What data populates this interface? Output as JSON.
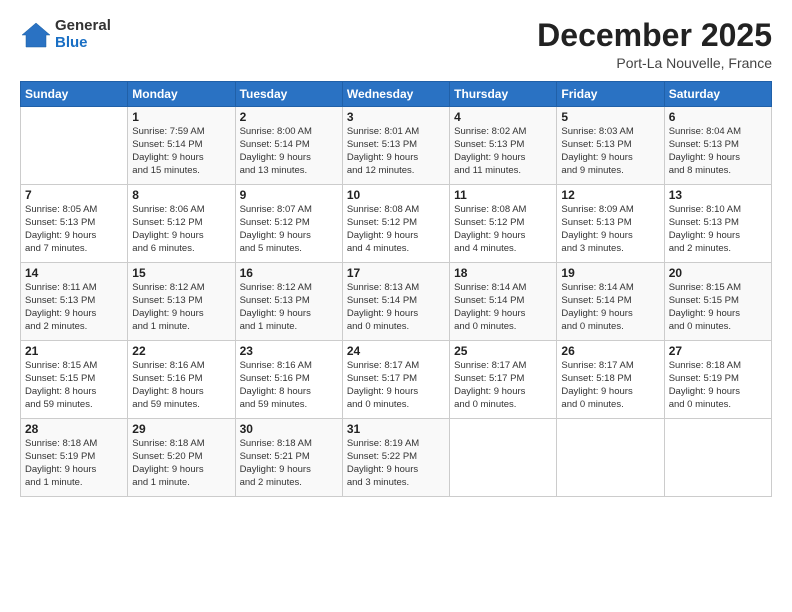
{
  "logo": {
    "general": "General",
    "blue": "Blue"
  },
  "header": {
    "month": "December 2025",
    "location": "Port-La Nouvelle, France"
  },
  "weekdays": [
    "Sunday",
    "Monday",
    "Tuesday",
    "Wednesday",
    "Thursday",
    "Friday",
    "Saturday"
  ],
  "weeks": [
    [
      {
        "day": "",
        "info": ""
      },
      {
        "day": "1",
        "info": "Sunrise: 7:59 AM\nSunset: 5:14 PM\nDaylight: 9 hours\nand 15 minutes."
      },
      {
        "day": "2",
        "info": "Sunrise: 8:00 AM\nSunset: 5:14 PM\nDaylight: 9 hours\nand 13 minutes."
      },
      {
        "day": "3",
        "info": "Sunrise: 8:01 AM\nSunset: 5:13 PM\nDaylight: 9 hours\nand 12 minutes."
      },
      {
        "day": "4",
        "info": "Sunrise: 8:02 AM\nSunset: 5:13 PM\nDaylight: 9 hours\nand 11 minutes."
      },
      {
        "day": "5",
        "info": "Sunrise: 8:03 AM\nSunset: 5:13 PM\nDaylight: 9 hours\nand 9 minutes."
      },
      {
        "day": "6",
        "info": "Sunrise: 8:04 AM\nSunset: 5:13 PM\nDaylight: 9 hours\nand 8 minutes."
      }
    ],
    [
      {
        "day": "7",
        "info": "Sunrise: 8:05 AM\nSunset: 5:13 PM\nDaylight: 9 hours\nand 7 minutes."
      },
      {
        "day": "8",
        "info": "Sunrise: 8:06 AM\nSunset: 5:12 PM\nDaylight: 9 hours\nand 6 minutes."
      },
      {
        "day": "9",
        "info": "Sunrise: 8:07 AM\nSunset: 5:12 PM\nDaylight: 9 hours\nand 5 minutes."
      },
      {
        "day": "10",
        "info": "Sunrise: 8:08 AM\nSunset: 5:12 PM\nDaylight: 9 hours\nand 4 minutes."
      },
      {
        "day": "11",
        "info": "Sunrise: 8:08 AM\nSunset: 5:12 PM\nDaylight: 9 hours\nand 4 minutes."
      },
      {
        "day": "12",
        "info": "Sunrise: 8:09 AM\nSunset: 5:13 PM\nDaylight: 9 hours\nand 3 minutes."
      },
      {
        "day": "13",
        "info": "Sunrise: 8:10 AM\nSunset: 5:13 PM\nDaylight: 9 hours\nand 2 minutes."
      }
    ],
    [
      {
        "day": "14",
        "info": "Sunrise: 8:11 AM\nSunset: 5:13 PM\nDaylight: 9 hours\nand 2 minutes."
      },
      {
        "day": "15",
        "info": "Sunrise: 8:12 AM\nSunset: 5:13 PM\nDaylight: 9 hours\nand 1 minute."
      },
      {
        "day": "16",
        "info": "Sunrise: 8:12 AM\nSunset: 5:13 PM\nDaylight: 9 hours\nand 1 minute."
      },
      {
        "day": "17",
        "info": "Sunrise: 8:13 AM\nSunset: 5:14 PM\nDaylight: 9 hours\nand 0 minutes."
      },
      {
        "day": "18",
        "info": "Sunrise: 8:14 AM\nSunset: 5:14 PM\nDaylight: 9 hours\nand 0 minutes."
      },
      {
        "day": "19",
        "info": "Sunrise: 8:14 AM\nSunset: 5:14 PM\nDaylight: 9 hours\nand 0 minutes."
      },
      {
        "day": "20",
        "info": "Sunrise: 8:15 AM\nSunset: 5:15 PM\nDaylight: 9 hours\nand 0 minutes."
      }
    ],
    [
      {
        "day": "21",
        "info": "Sunrise: 8:15 AM\nSunset: 5:15 PM\nDaylight: 8 hours\nand 59 minutes."
      },
      {
        "day": "22",
        "info": "Sunrise: 8:16 AM\nSunset: 5:16 PM\nDaylight: 8 hours\nand 59 minutes."
      },
      {
        "day": "23",
        "info": "Sunrise: 8:16 AM\nSunset: 5:16 PM\nDaylight: 8 hours\nand 59 minutes."
      },
      {
        "day": "24",
        "info": "Sunrise: 8:17 AM\nSunset: 5:17 PM\nDaylight: 9 hours\nand 0 minutes."
      },
      {
        "day": "25",
        "info": "Sunrise: 8:17 AM\nSunset: 5:17 PM\nDaylight: 9 hours\nand 0 minutes."
      },
      {
        "day": "26",
        "info": "Sunrise: 8:17 AM\nSunset: 5:18 PM\nDaylight: 9 hours\nand 0 minutes."
      },
      {
        "day": "27",
        "info": "Sunrise: 8:18 AM\nSunset: 5:19 PM\nDaylight: 9 hours\nand 0 minutes."
      }
    ],
    [
      {
        "day": "28",
        "info": "Sunrise: 8:18 AM\nSunset: 5:19 PM\nDaylight: 9 hours\nand 1 minute."
      },
      {
        "day": "29",
        "info": "Sunrise: 8:18 AM\nSunset: 5:20 PM\nDaylight: 9 hours\nand 1 minute."
      },
      {
        "day": "30",
        "info": "Sunrise: 8:18 AM\nSunset: 5:21 PM\nDaylight: 9 hours\nand 2 minutes."
      },
      {
        "day": "31",
        "info": "Sunrise: 8:19 AM\nSunset: 5:22 PM\nDaylight: 9 hours\nand 3 minutes."
      },
      {
        "day": "",
        "info": ""
      },
      {
        "day": "",
        "info": ""
      },
      {
        "day": "",
        "info": ""
      }
    ]
  ]
}
